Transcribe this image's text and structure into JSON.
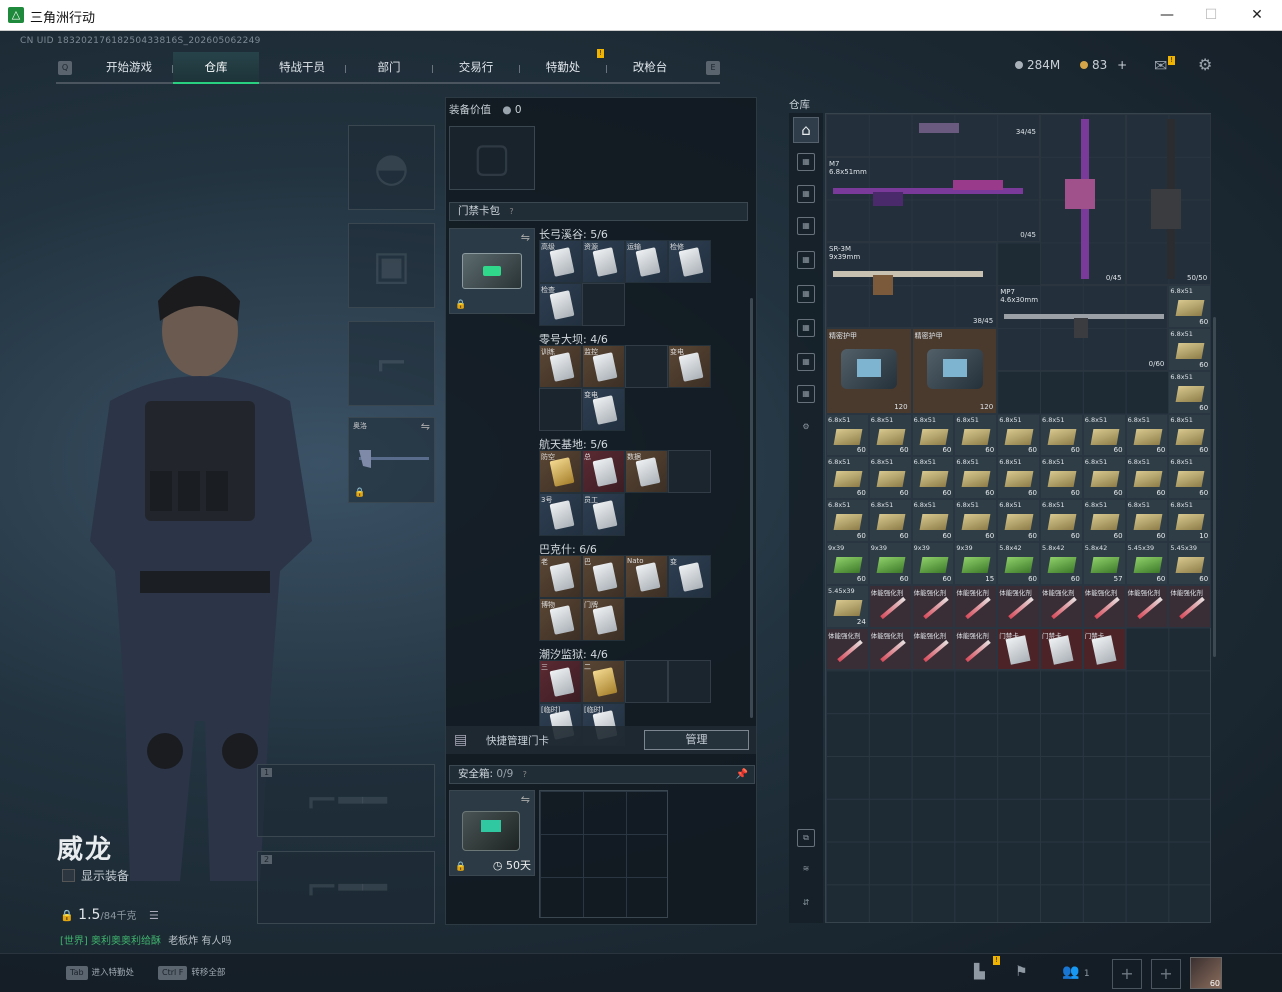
{
  "window": {
    "title": "三角洲行动"
  },
  "uid": "CN UID 18320217618250433816S_202605062249",
  "nav": {
    "left_key": "Q",
    "right_key": "E",
    "tabs": [
      "开始游戏",
      "仓库",
      "特战干员",
      "部门",
      "交易行",
      "特勤处",
      "改枪台"
    ],
    "active": "仓库"
  },
  "currency": {
    "money": "284M",
    "coins": "83",
    "coin_plus": "+"
  },
  "colors": {
    "accent_green": "#29d080",
    "badge_yellow": "#f0b400"
  },
  "operator": {
    "name": "威龙",
    "show_equipment": "显示装备",
    "weight_value": "1.5",
    "weight_limit": "/84千克",
    "melee_label": "奥洛",
    "weapon_slots": [
      "1",
      "2"
    ]
  },
  "chat": {
    "channel": "[世界]",
    "user": "奥利奥奥利给酥",
    "text": "老板炸 有人吗"
  },
  "bottom_hints": [
    {
      "key": "Tab",
      "label": "进入特勤处"
    },
    {
      "key": "Ctrl F",
      "label": "转移全部"
    }
  ],
  "bottom_right": {
    "friends_count": "1",
    "avatar_level": "60"
  },
  "middle": {
    "equip_value_label": "装备价值",
    "equip_value": "0",
    "keycard_pack_label": "门禁卡包",
    "quick_manage_label": "快捷管理门卡",
    "manage_button": "管理",
    "safebox_label": "安全箱:",
    "safebox_count": "0/9",
    "safebox_days": "50天",
    "zones": [
      {
        "name": "长弓溪谷: 5/6",
        "cards": [
          {
            "label": "高级",
            "color": "blue",
            "gold": false
          },
          {
            "label": "资源",
            "color": "blue",
            "gold": false
          },
          {
            "label": "运输",
            "color": "blue",
            "gold": false
          },
          {
            "label": "检修",
            "color": "blue",
            "gold": false
          },
          {
            "label": "检查",
            "color": "blue",
            "gold": false
          }
        ]
      },
      {
        "name": "零号大坝: 4/6",
        "cards": [
          {
            "label": "训练",
            "color": "brown",
            "gold": false
          },
          {
            "label": "监控",
            "color": "brown",
            "gold": false
          },
          {
            "label": "",
            "color": "empty",
            "gold": false
          },
          {
            "label": "变电",
            "color": "brown",
            "gold": false
          },
          {
            "label": "",
            "color": "empty",
            "gold": false
          },
          {
            "label": "变电",
            "color": "blue",
            "gold": false
          }
        ]
      },
      {
        "name": "航天基地: 5/6",
        "cards": [
          {
            "label": "防空",
            "color": "brown",
            "gold": true
          },
          {
            "label": "总",
            "color": "red",
            "gold": false
          },
          {
            "label": "数据",
            "color": "brown",
            "gold": false
          },
          {
            "label": "",
            "color": "empty",
            "gold": false
          },
          {
            "label": "3号",
            "color": "blue",
            "gold": false
          },
          {
            "label": "员工",
            "color": "blue",
            "gold": false
          }
        ]
      },
      {
        "name": "巴克什: 6/6",
        "cards": [
          {
            "label": "老",
            "color": "brown",
            "gold": false
          },
          {
            "label": "巴",
            "color": "brown",
            "gold": false
          },
          {
            "label": "Nato",
            "color": "brown",
            "gold": false
          },
          {
            "label": "变",
            "color": "blue",
            "gold": false
          },
          {
            "label": "博物",
            "color": "brown",
            "gold": false
          },
          {
            "label": "门牌",
            "color": "brown",
            "gold": false
          }
        ]
      },
      {
        "name": "潮汐监狱: 4/6",
        "cards": [
          {
            "label": "三",
            "color": "red",
            "gold": false
          },
          {
            "label": "二",
            "color": "brown",
            "gold": true
          },
          {
            "label": "",
            "color": "empty",
            "gold": false
          },
          {
            "label": "",
            "color": "empty",
            "gold": false
          },
          {
            "label": "[临时]",
            "color": "blue",
            "gold": false
          },
          {
            "label": "[临时]",
            "color": "blue",
            "gold": false
          }
        ]
      }
    ]
  },
  "warehouse": {
    "title": "仓库",
    "guns": [
      {
        "name": "M7",
        "caliber": "6.8x51mm",
        "ammo": "34/45",
        "mag": "0/45"
      },
      {
        "name": "SR-3M",
        "caliber": "9x39mm",
        "ammo": "38/45"
      },
      {
        "name": "MP7",
        "caliber": "4.6x30mm",
        "ammo": "0/60"
      },
      {
        "name": "",
        "caliber": "",
        "ammo": "0/45"
      },
      {
        "name": "",
        "caliber": "",
        "ammo": "50/50"
      }
    ],
    "armor": [
      {
        "name": "精密护甲",
        "dur": "120"
      },
      {
        "name": "精密护甲",
        "dur": "120"
      }
    ],
    "items": [
      {
        "name": "6.8x51",
        "count": "60",
        "kind": "ammo"
      },
      {
        "name": "6.8x51",
        "count": "60",
        "kind": "ammo"
      },
      {
        "name": "6.8x51",
        "count": "60",
        "kind": "ammo"
      },
      {
        "name": "6.8x51",
        "count": "60",
        "kind": "ammo"
      },
      {
        "name": "6.8x51",
        "count": "60",
        "kind": "ammo"
      },
      {
        "name": "6.8x51",
        "count": "60",
        "kind": "ammo"
      },
      {
        "name": "6.8x51",
        "count": "60",
        "kind": "ammo"
      },
      {
        "name": "6.8x51",
        "count": "60",
        "kind": "ammo"
      },
      {
        "name": "6.8x51",
        "count": "60",
        "kind": "ammo"
      },
      {
        "name": "6.8x51",
        "count": "60",
        "kind": "ammo"
      },
      {
        "name": "6.8x51",
        "count": "60",
        "kind": "ammo"
      },
      {
        "name": "6.8x51",
        "count": "60",
        "kind": "ammo"
      },
      {
        "name": "6.8x51",
        "count": "60",
        "kind": "ammo"
      },
      {
        "name": "6.8x51",
        "count": "60",
        "kind": "ammo"
      },
      {
        "name": "6.8x51",
        "count": "60",
        "kind": "ammo"
      },
      {
        "name": "6.8x51",
        "count": "60",
        "kind": "ammo"
      },
      {
        "name": "6.8x51",
        "count": "60",
        "kind": "ammo"
      },
      {
        "name": "6.8x51",
        "count": "60",
        "kind": "ammo"
      },
      {
        "name": "6.8x51",
        "count": "60",
        "kind": "ammo"
      },
      {
        "name": "6.8x51",
        "count": "60",
        "kind": "ammo"
      },
      {
        "name": "6.8x51",
        "count": "60",
        "kind": "ammo"
      },
      {
        "name": "6.8x51",
        "count": "60",
        "kind": "ammo"
      },
      {
        "name": "6.8x51",
        "count": "60",
        "kind": "ammo"
      },
      {
        "name": "6.8x51",
        "count": "60",
        "kind": "ammo"
      },
      {
        "name": "6.8x51",
        "count": "60",
        "kind": "ammo"
      },
      {
        "name": "6.8x51",
        "count": "60",
        "kind": "ammo"
      },
      {
        "name": "6.8x51",
        "count": "10",
        "kind": "ammo"
      },
      {
        "name": "9x39",
        "count": "60",
        "kind": "ammo green"
      },
      {
        "name": "9x39",
        "count": "60",
        "kind": "ammo green"
      },
      {
        "name": "9x39",
        "count": "60",
        "kind": "ammo green"
      },
      {
        "name": "9x39",
        "count": "15",
        "kind": "ammo green"
      },
      {
        "name": "5.8x42",
        "count": "60",
        "kind": "ammo green"
      },
      {
        "name": "5.8x42",
        "count": "60",
        "kind": "ammo green"
      },
      {
        "name": "5.8x42",
        "count": "57",
        "kind": "ammo green"
      },
      {
        "name": "5.45x39",
        "count": "60",
        "kind": "ammo green"
      },
      {
        "name": "5.45x39",
        "count": "60",
        "kind": "ammo"
      },
      {
        "name": "5.45x39",
        "count": "24",
        "kind": "ammo"
      },
      {
        "name": "体能强化剂",
        "count": "",
        "kind": "med"
      },
      {
        "name": "体能强化剂",
        "count": "",
        "kind": "med"
      },
      {
        "name": "体能强化剂",
        "count": "",
        "kind": "med"
      },
      {
        "name": "体能强化剂",
        "count": "",
        "kind": "med"
      },
      {
        "name": "体能强化剂",
        "count": "",
        "kind": "med"
      },
      {
        "name": "体能强化剂",
        "count": "",
        "kind": "med"
      },
      {
        "name": "体能强化剂",
        "count": "",
        "kind": "med"
      },
      {
        "name": "体能强化剂",
        "count": "",
        "kind": "med"
      },
      {
        "name": "体能强化剂",
        "count": "",
        "kind": "med"
      },
      {
        "name": "体能强化剂",
        "count": "",
        "kind": "med"
      },
      {
        "name": "体能强化剂",
        "count": "",
        "kind": "med"
      },
      {
        "name": "体能强化剂",
        "count": "",
        "kind": "med"
      },
      {
        "name": "门禁卡",
        "count": "",
        "kind": "redcard"
      },
      {
        "name": "门禁卡",
        "count": "",
        "kind": "redcard"
      },
      {
        "name": "门禁卡",
        "count": "",
        "kind": "redcard"
      }
    ],
    "side_ammo": [
      {
        "name": "6.8x51",
        "count": "60"
      },
      {
        "name": "6.8x51",
        "count": "60"
      },
      {
        "name": "6.8x51",
        "count": "60"
      }
    ]
  }
}
